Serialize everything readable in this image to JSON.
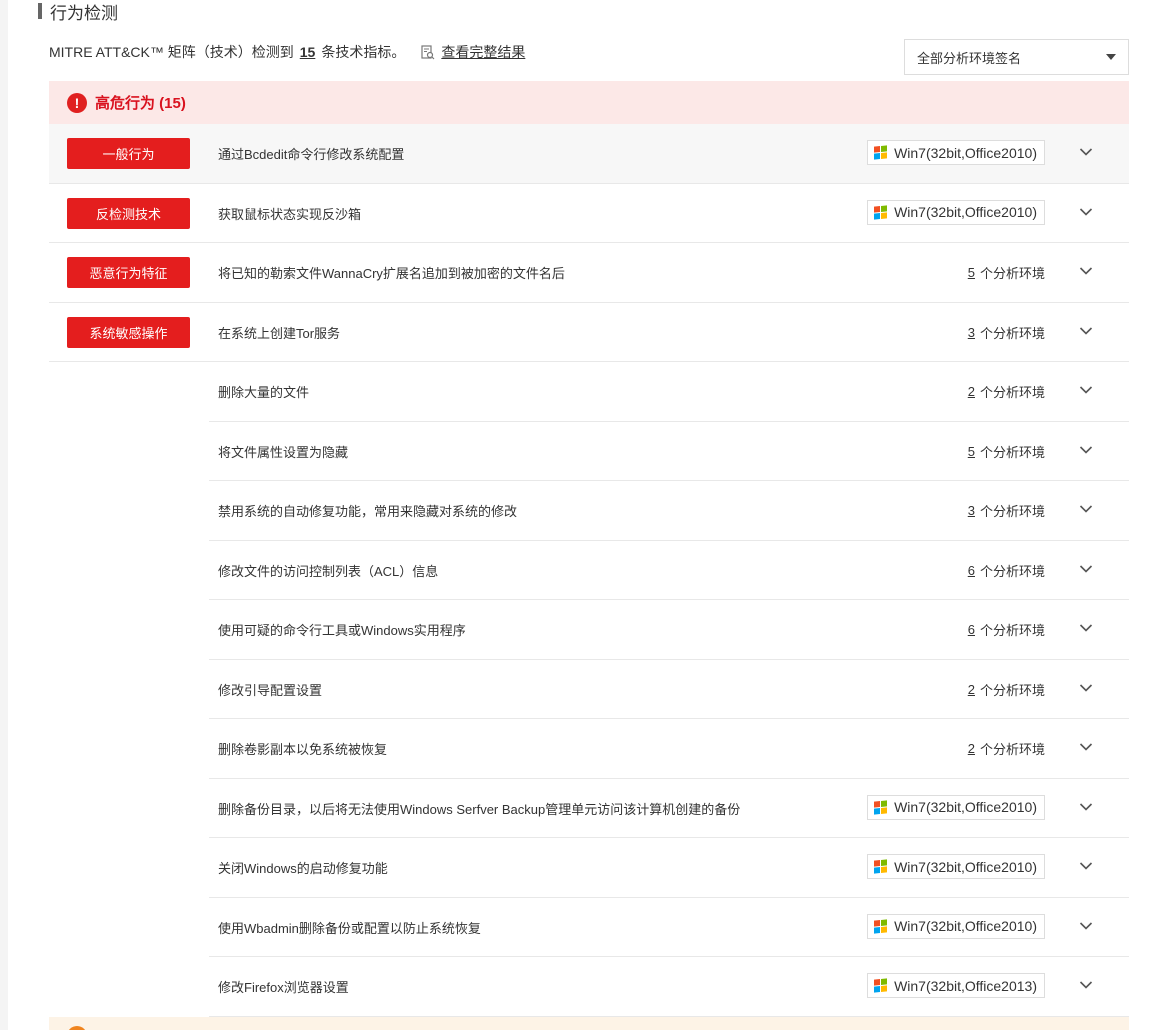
{
  "section": {
    "title": "行为检测"
  },
  "summary": {
    "prefix": "MITRE ATT&CK™ 矩阵（技术）检测到",
    "count": "15",
    "suffix": "条技术指标。",
    "full_link": "查看完整结果"
  },
  "filter": {
    "selected": "全部分析环境签名"
  },
  "group": {
    "title": "高危行为 (15)",
    "icon": "alert-circle-icon",
    "color": "#e02020"
  },
  "colors": {
    "tag_red": "#e41e1e",
    "header_bg": "#fce8e7"
  },
  "rows": [
    {
      "tag": "一般行为",
      "label": "通过Bcdedit命令行修改系统配置",
      "env": "Win7(32bit,Office2010)"
    },
    {
      "tag": "反检测技术",
      "label": "获取鼠标状态实现反沙箱",
      "env": "Win7(32bit,Office2010)"
    },
    {
      "tag": "恶意行为特征",
      "label": "将已知的勒索文件WannaCry扩展名追加到被加密的文件名后",
      "count": "5",
      "count_suffix": "个分析环境"
    },
    {
      "tag": "系统敏感操作",
      "label": "在系统上创建Tor服务",
      "count": "3",
      "count_suffix": "个分析环境"
    },
    {
      "label": "删除大量的文件",
      "count": "2",
      "count_suffix": "个分析环境"
    },
    {
      "label": "将文件属性设置为隐藏",
      "count": "5",
      "count_suffix": "个分析环境"
    },
    {
      "label": "禁用系统的自动修复功能，常用来隐藏对系统的修改",
      "count": "3",
      "count_suffix": "个分析环境"
    },
    {
      "label": "修改文件的访问控制列表（ACL）信息",
      "count": "6",
      "count_suffix": "个分析环境"
    },
    {
      "label": "使用可疑的命令行工具或Windows实用程序",
      "count": "6",
      "count_suffix": "个分析环境"
    },
    {
      "label": "修改引导配置设置",
      "count": "2",
      "count_suffix": "个分析环境"
    },
    {
      "label": "删除卷影副本以免系统被恢复",
      "count": "2",
      "count_suffix": "个分析环境"
    },
    {
      "label": "删除备份目录，以后将无法使用Windows Serfver Backup管理单元访问该计算机创建的备份",
      "env": "Win7(32bit,Office2010)"
    },
    {
      "label": "关闭Windows的启动修复功能",
      "env": "Win7(32bit,Office2010)"
    },
    {
      "label": "使用Wbadmin删除备份或配置以防止系统恢复",
      "env": "Win7(32bit,Office2010)"
    },
    {
      "label": "修改Firefox浏览器设置",
      "env": "Win7(32bit,Office2013)"
    }
  ]
}
